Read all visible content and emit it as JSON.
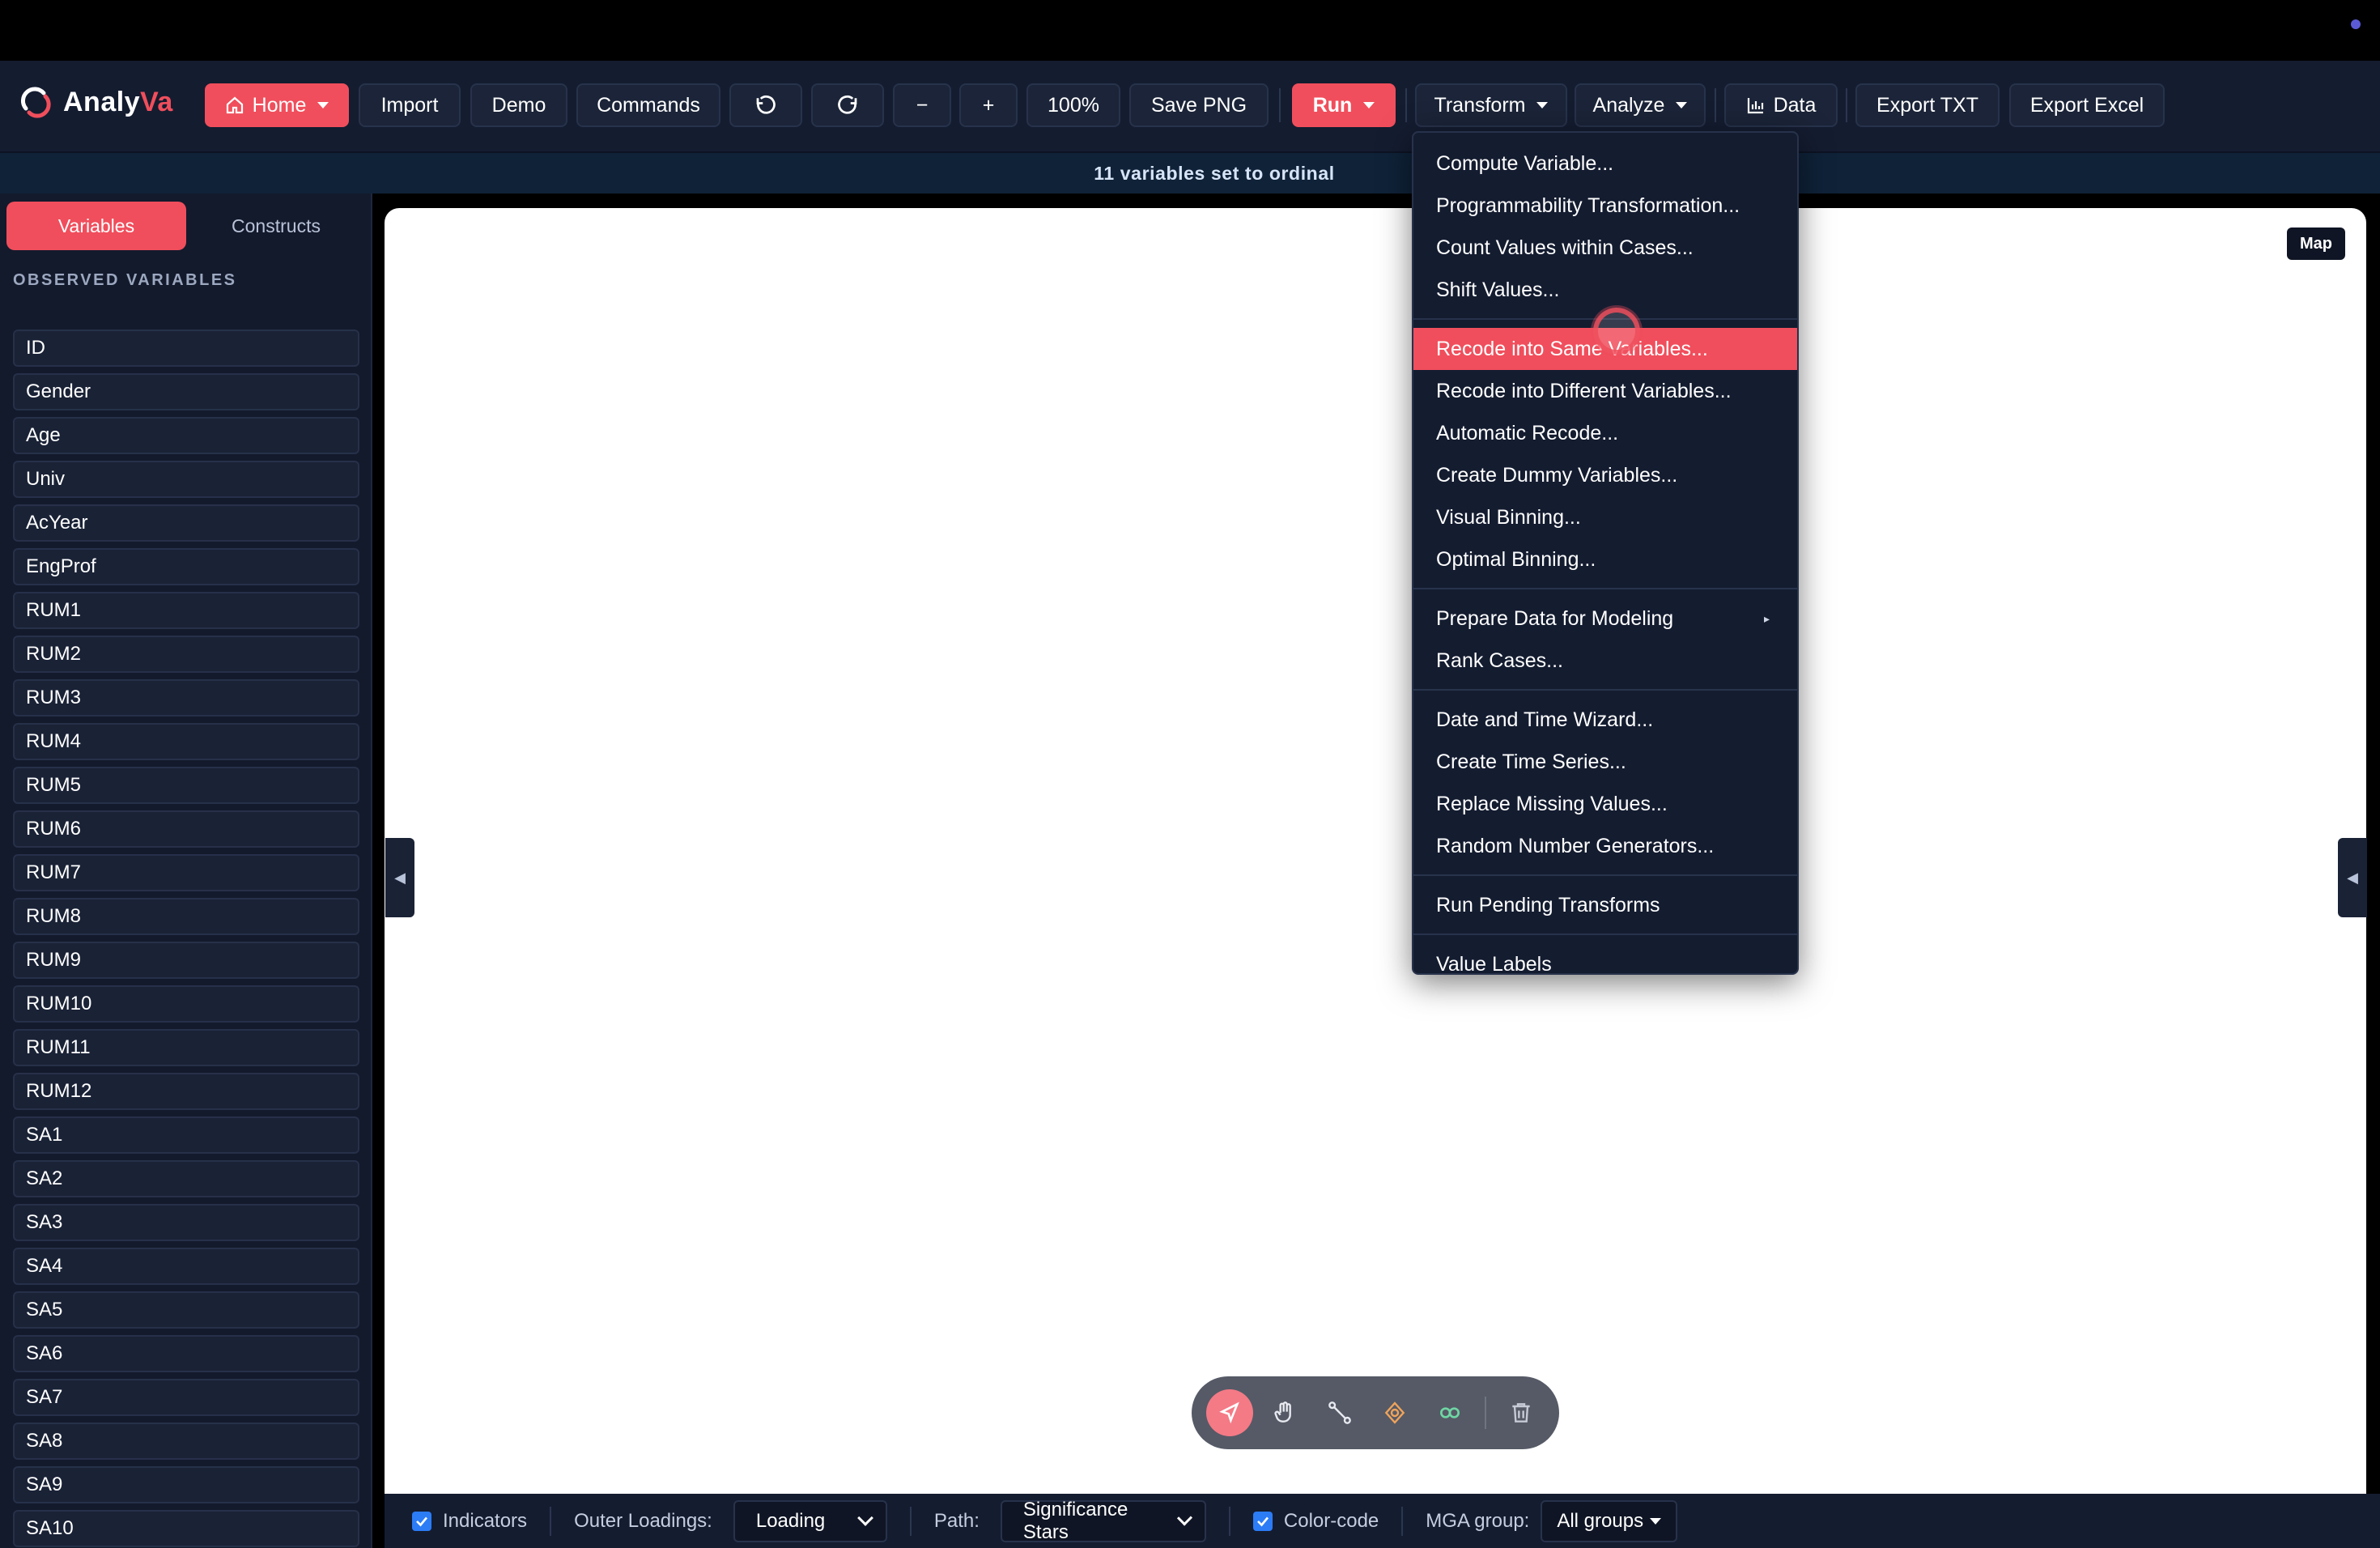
{
  "app": {
    "name_part1": "Analy",
    "name_part2": "Va"
  },
  "toolbar": {
    "home": "Home",
    "import": "Import",
    "demo": "Demo",
    "commands": "Commands",
    "undo_icon": "undo-icon",
    "redo_icon": "redo-icon",
    "zoom_out": "−",
    "zoom_in": "+",
    "zoom_level": "100%",
    "save_png": "Save PNG",
    "run": "Run",
    "transform": "Transform",
    "analyze": "Analyze",
    "data": "Data",
    "export_txt": "Export TXT",
    "export_excel": "Export Excel"
  },
  "notice": "11 variables set to ordinal",
  "sidebar": {
    "tabs": [
      "Variables",
      "Constructs"
    ],
    "active_tab": "Variables",
    "section_heading": "OBSERVED VARIABLES",
    "variables": [
      "ID",
      "Gender",
      "Age",
      "Univ",
      "AcYear",
      "EngProf",
      "RUM1",
      "RUM2",
      "RUM3",
      "RUM4",
      "RUM5",
      "RUM6",
      "RUM7",
      "RUM8",
      "RUM9",
      "RUM10",
      "RUM11",
      "RUM12",
      "SA1",
      "SA2",
      "SA3",
      "SA4",
      "SA5",
      "SA6",
      "SA7",
      "SA8",
      "SA9",
      "SA10"
    ]
  },
  "canvas": {
    "map_button": "Map"
  },
  "transform_menu": {
    "groups": [
      [
        "Compute Variable...",
        "Programmability Transformation...",
        "Count Values within Cases...",
        "Shift Values..."
      ],
      [
        "Recode into Same Variables...",
        "Recode into Different Variables...",
        "Automatic Recode...",
        "Create Dummy Variables...",
        "Visual Binning...",
        "Optimal Binning..."
      ],
      [
        "Prepare Data for Modeling",
        "Rank Cases..."
      ],
      [
        "Date and Time Wizard...",
        "Create Time Series...",
        "Replace Missing Values...",
        "Random Number Generators..."
      ],
      [
        "Run Pending Transforms"
      ],
      [
        "Value Labels"
      ]
    ],
    "highlighted": "Recode into Same Variables...",
    "submenu_item": "Prepare Data for Modeling"
  },
  "bottom_bar": {
    "indicators_label": "Indicators",
    "indicators_checked": true,
    "outer_loadings_label": "Outer Loadings:",
    "outer_loadings_value": "Loading",
    "path_label": "Path:",
    "path_value": "Significance Stars",
    "color_code_label": "Color-code",
    "color_code_checked": true,
    "mga_label": "MGA group:",
    "mga_value": "All groups"
  },
  "colors": {
    "accent": "#f04e5c",
    "background": "#141c30",
    "panel": "#131a2c",
    "checkbox": "#2c7cf6"
  }
}
